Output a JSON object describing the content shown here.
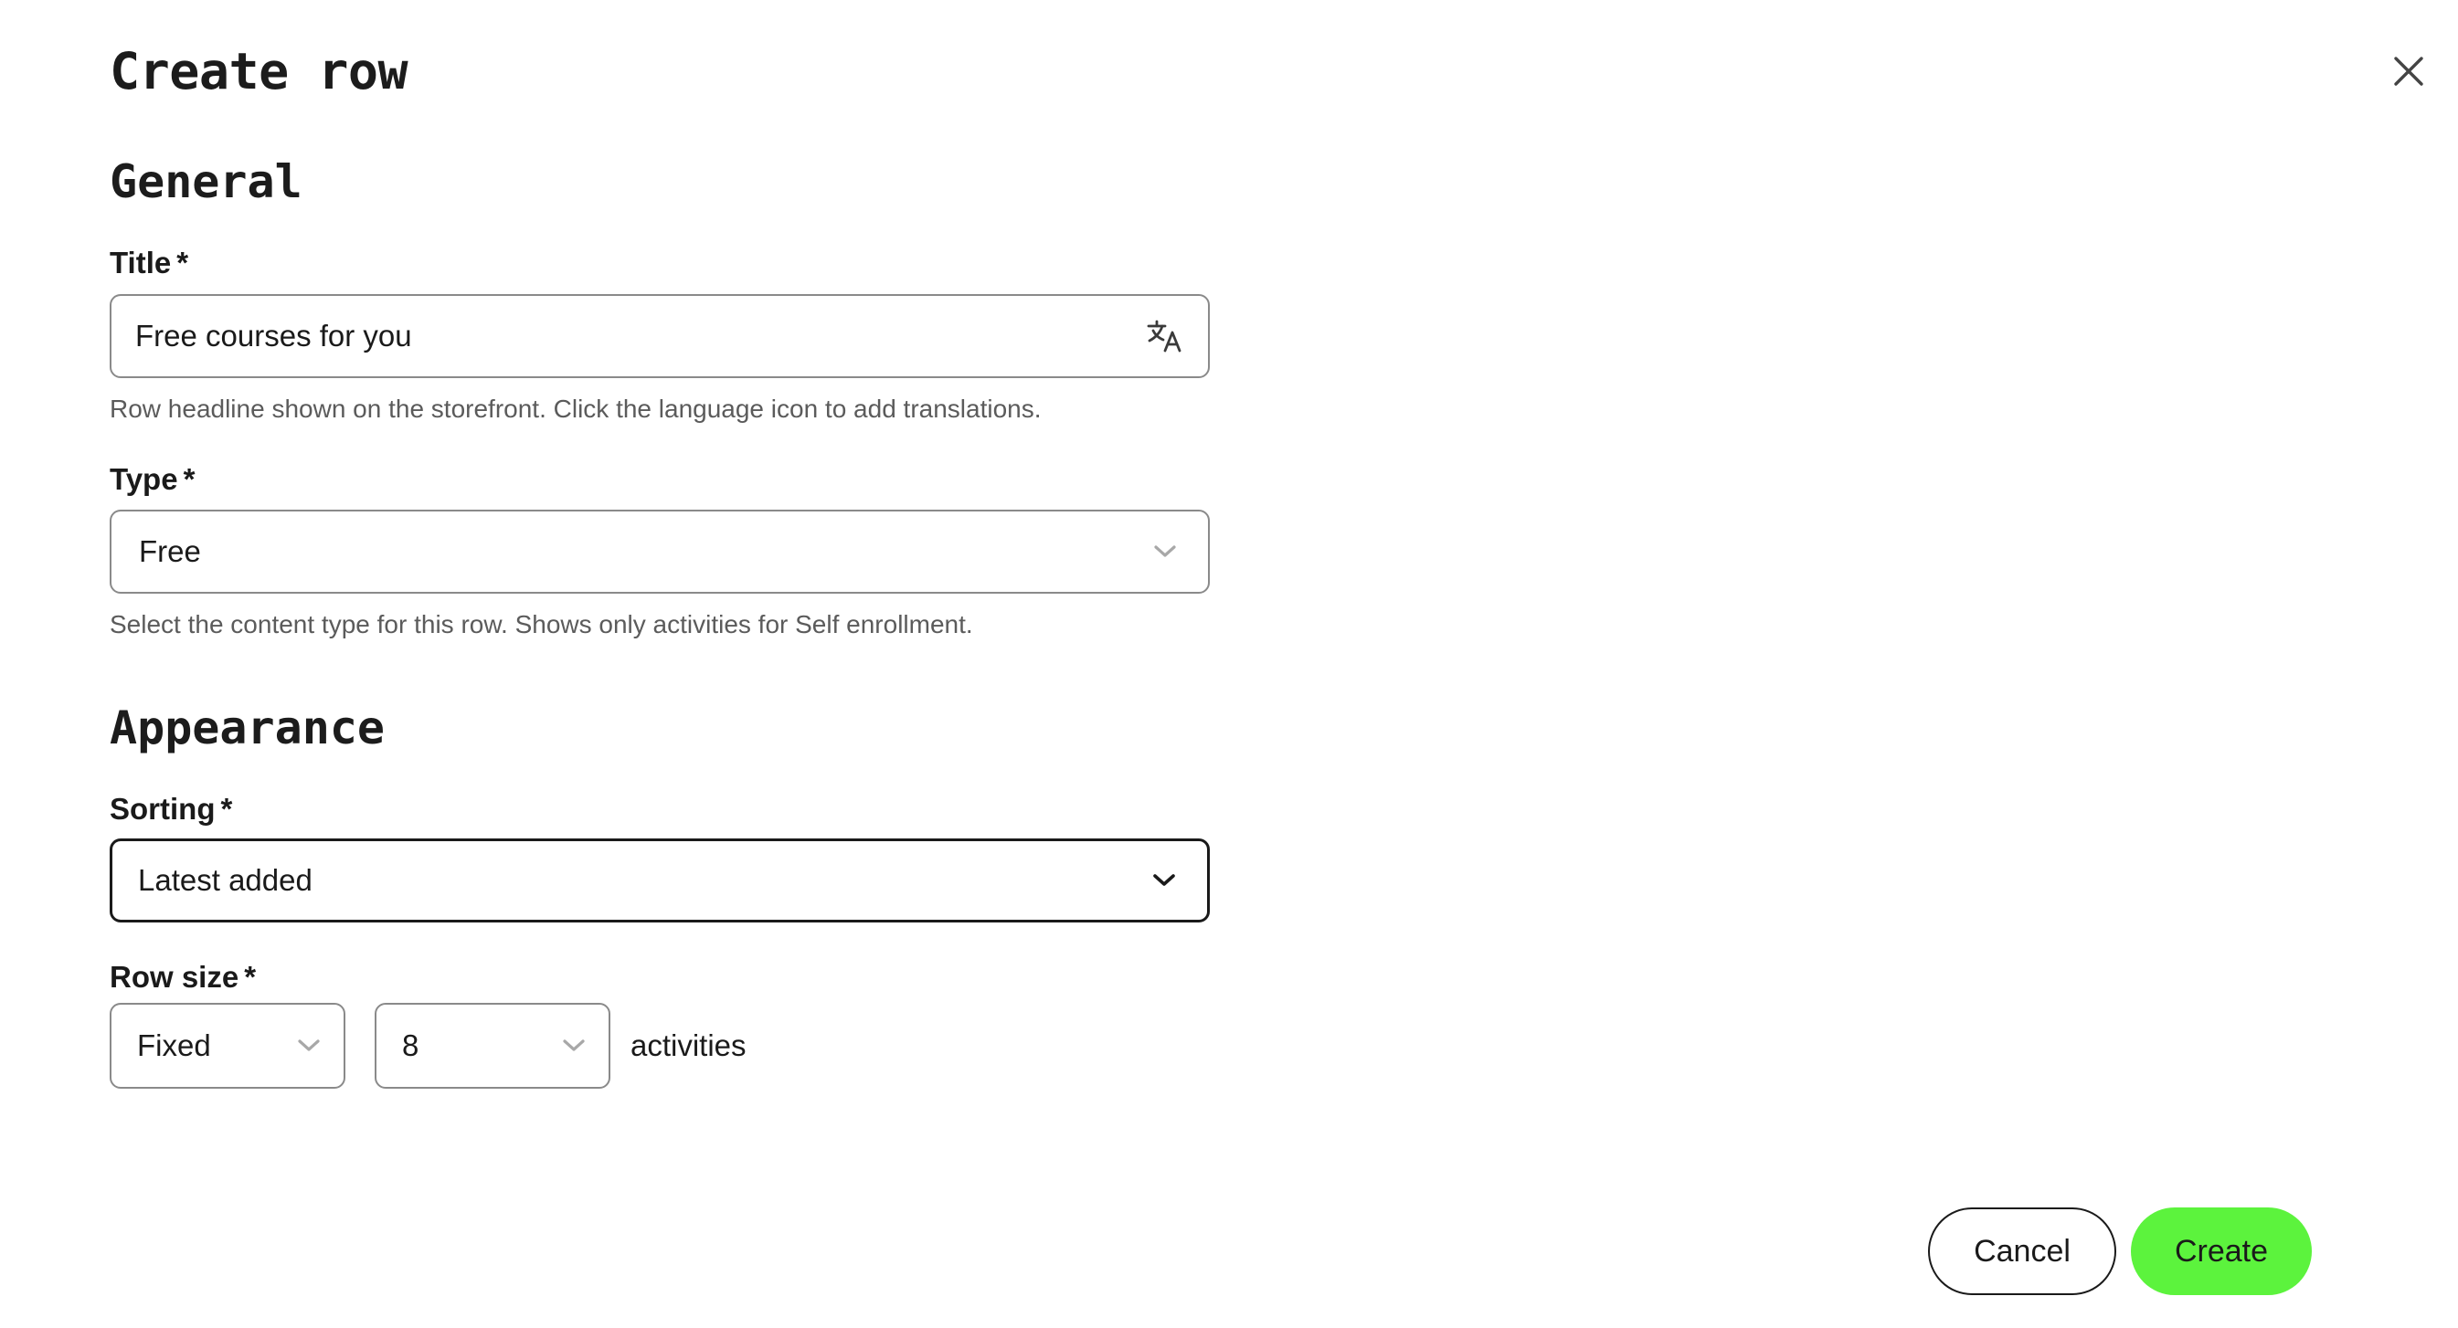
{
  "dialog": {
    "title": "Create row",
    "close_icon": "close-icon"
  },
  "general": {
    "heading": "General",
    "title_field": {
      "label": "Title",
      "required_mark": "*",
      "value": "Free courses for you",
      "icon": "translate-icon",
      "help": "Row headline shown on the storefront. Click the language icon to add translations."
    },
    "type_field": {
      "label": "Type",
      "required_mark": "*",
      "value": "Free",
      "icon": "chevron-down-icon",
      "help": "Select the content type for this row. Shows only activities for Self enrollment."
    }
  },
  "appearance": {
    "heading": "Appearance",
    "sorting_field": {
      "label": "Sorting",
      "required_mark": "*",
      "value": "Latest added",
      "icon": "chevron-down-icon"
    },
    "row_size": {
      "label": "Row size",
      "required_mark": "*",
      "mode_value": "Fixed",
      "count_value": "8",
      "suffix": "activities"
    }
  },
  "footer": {
    "cancel_label": "Cancel",
    "create_label": "Create"
  },
  "colors": {
    "primary_button": "#5cf33d",
    "text": "#1a1a1a",
    "muted_text": "#5b5b5b",
    "border": "#8a8a8a"
  }
}
